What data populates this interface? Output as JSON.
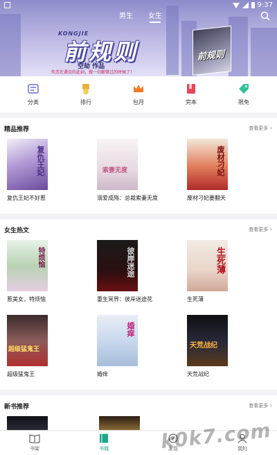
{
  "status_bar": {
    "time": "9:37"
  },
  "gender_tabs": [
    "男生",
    "女生"
  ],
  "banner": {
    "logo_sub": "KONGJIE",
    "title": "前规则",
    "author": "空劫 作品",
    "slogan": "失恋在遇见的此刻，做一切都错过的时候了！",
    "book_cover_text": "前规则"
  },
  "quick_nav": [
    {
      "label": "分类",
      "icon": "category-icon",
      "color": "#6b6bd6"
    },
    {
      "label": "排行",
      "icon": "ranking-medal-icon",
      "color": "#e8b23a"
    },
    {
      "label": "包月",
      "icon": "crown-icon",
      "color": "#f07a2a"
    },
    {
      "label": "完本",
      "icon": "book-finished-icon",
      "color": "#e8455a"
    },
    {
      "label": "限免",
      "icon": "free-tag-icon",
      "color": "#2fc39a"
    }
  ],
  "sections": [
    {
      "title": "精品推荐",
      "more": "查看更多",
      "books": [
        {
          "title": "复仇王妃不好惹",
          "cover_text": "复仇王妃"
        },
        {
          "title": "溺爱成殇：总裁索妻无度",
          "cover_text": "索妻无度"
        },
        {
          "title": "废材刁妃要翻天",
          "cover_text": "废材刁妃"
        }
      ]
    },
    {
      "title": "女生热文",
      "more": "查看更多",
      "books": [
        {
          "title": "惹美女，特烦恼",
          "cover_text": "特烦恼"
        },
        {
          "title": "重生冥界：彼岸迷途花",
          "cover_text": "彼岸迷途"
        },
        {
          "title": "生死薄",
          "cover_text": "生死薄"
        },
        {
          "title": "超级猛鬼王",
          "cover_text": "超级猛鬼王"
        },
        {
          "title": "婚痒",
          "cover_text": "婚痒"
        },
        {
          "title": "天荒战纪",
          "cover_text": "天荒战纪"
        }
      ]
    },
    {
      "title": "新书推荐",
      "more": "查看更多"
    }
  ],
  "bottom_nav": [
    {
      "label": "书架",
      "active": false
    },
    {
      "label": "书城",
      "active": true
    },
    {
      "label": "发现",
      "active": false
    },
    {
      "label": "我的",
      "active": false
    }
  ],
  "colors": {
    "accent": "#1aa886",
    "banner_purple": "#8d8bc9"
  },
  "watermark": "k0k7.com"
}
